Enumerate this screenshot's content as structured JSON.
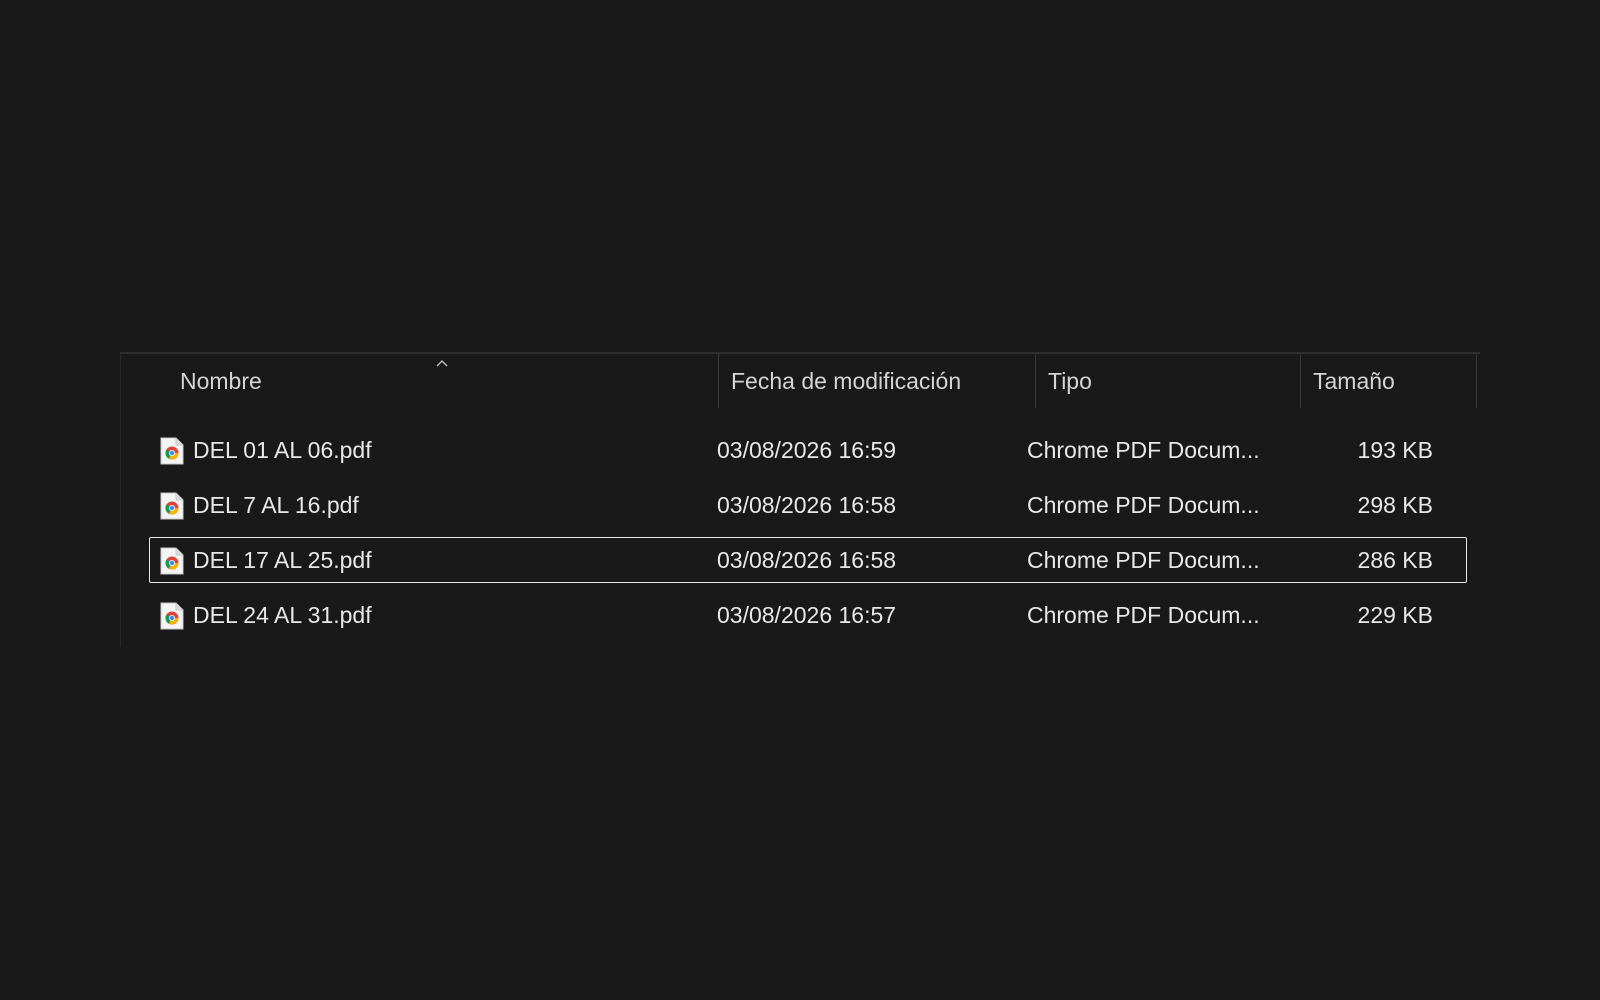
{
  "columns": {
    "name": "Nombre",
    "date": "Fecha de modificación",
    "type": "Tipo",
    "size": "Tamaño"
  },
  "sort": {
    "column": "name",
    "icon": "chevron-up-icon"
  },
  "files": [
    {
      "name": "DEL 01 AL 06.pdf",
      "date": "03/08/2026 16:59",
      "type": "Chrome PDF Docum...",
      "size": "193 KB",
      "icon": "chrome-pdf-icon",
      "selected": false
    },
    {
      "name": "DEL 7 AL 16.pdf",
      "date": "03/08/2026 16:58",
      "type": "Chrome PDF Docum...",
      "size": "298 KB",
      "icon": "chrome-pdf-icon",
      "selected": false
    },
    {
      "name": "DEL 17 AL 25.pdf",
      "date": "03/08/2026 16:58",
      "type": "Chrome PDF Docum...",
      "size": "286 KB",
      "icon": "chrome-pdf-icon",
      "selected": true
    },
    {
      "name": "DEL 24 AL 31.pdf",
      "date": "03/08/2026 16:57",
      "type": "Chrome PDF Docum...",
      "size": "229 KB",
      "icon": "chrome-pdf-icon",
      "selected": false
    }
  ],
  "colors": {
    "background": "#191919",
    "text": "#e8e8e8",
    "selection_border": "#e6e6e6"
  }
}
